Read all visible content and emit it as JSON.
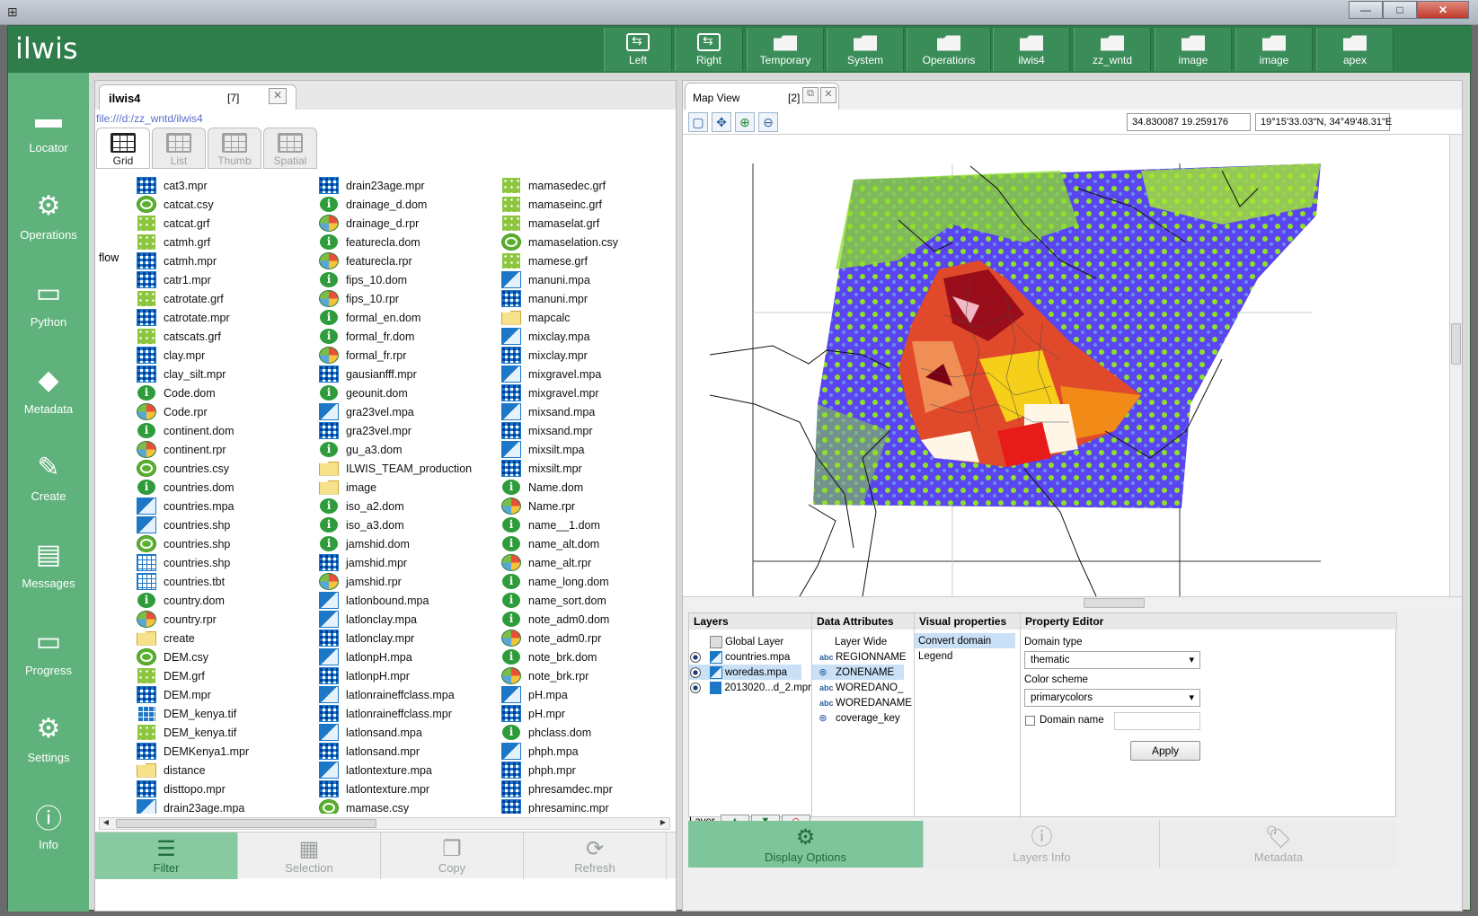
{
  "window": {
    "close": "✕",
    "maximize": "□",
    "minimize": "—"
  },
  "app": {
    "logo": "ilwis"
  },
  "toolbar": [
    {
      "label": "Left",
      "icon": "swap-icon"
    },
    {
      "label": "Right",
      "icon": "swap-icon"
    },
    {
      "label": "Temporary",
      "icon": "folder-icon"
    },
    {
      "label": "System",
      "icon": "folder-icon"
    },
    {
      "label": "Operations",
      "icon": "folder-icon"
    },
    {
      "label": "ilwis4",
      "icon": "folder-icon"
    },
    {
      "label": "zz_wntd",
      "icon": "folder-icon"
    },
    {
      "label": "image",
      "icon": "folder-icon"
    },
    {
      "label": "image",
      "icon": "folder-icon"
    },
    {
      "label": "apex",
      "icon": "folder-icon"
    }
  ],
  "sidebar": [
    {
      "label": "Locator",
      "icon": "folder-icon"
    },
    {
      "label": "Operations",
      "icon": "gears-icon"
    },
    {
      "label": "Python",
      "icon": "window-icon"
    },
    {
      "label": "Metadata",
      "icon": "tag-icon"
    },
    {
      "label": "Create",
      "icon": "edit-icon"
    },
    {
      "label": "Messages",
      "icon": "message-icon"
    },
    {
      "label": "Progress",
      "icon": "progress-icon"
    },
    {
      "label": "Settings",
      "icon": "gear-icon"
    },
    {
      "label": "Info",
      "icon": "info-icon"
    }
  ],
  "catalog": {
    "tab_title": "ilwis4",
    "tab_count": "[7]",
    "url": "file:///d:/zz_wntd/ilwis4",
    "view_tabs": [
      "Grid",
      "List",
      "Thumb",
      "Spatial"
    ],
    "side_label": "flow",
    "columns": [
      [
        {
          "name": "cat3.mpr",
          "type": "mpr"
        },
        {
          "name": "catcat.csy",
          "type": "csy"
        },
        {
          "name": "catcat.grf",
          "type": "grf"
        },
        {
          "name": "catmh.grf",
          "type": "grf"
        },
        {
          "name": "catmh.mpr",
          "type": "mpr"
        },
        {
          "name": "catr1.mpr",
          "type": "mpr"
        },
        {
          "name": "catrotate.grf",
          "type": "grf"
        },
        {
          "name": "catrotate.mpr",
          "type": "mpr"
        },
        {
          "name": "catscats.grf",
          "type": "grf"
        },
        {
          "name": "clay.mpr",
          "type": "mpr"
        },
        {
          "name": "clay_silt.mpr",
          "type": "mpr"
        },
        {
          "name": "Code.dom",
          "type": "dom"
        },
        {
          "name": "Code.rpr",
          "type": "rpr"
        },
        {
          "name": "continent.dom",
          "type": "dom"
        },
        {
          "name": "continent.rpr",
          "type": "rpr"
        },
        {
          "name": "countries.csy",
          "type": "csy"
        },
        {
          "name": "countries.dom",
          "type": "dom"
        },
        {
          "name": "countries.mpa",
          "type": "mpa"
        },
        {
          "name": "countries.shp",
          "type": "shp"
        },
        {
          "name": "countries.shp",
          "type": "csy"
        },
        {
          "name": "countries.shp",
          "type": "tbt"
        },
        {
          "name": "countries.tbt",
          "type": "tbt"
        },
        {
          "name": "country.dom",
          "type": "dom"
        },
        {
          "name": "country.rpr",
          "type": "rpr"
        },
        {
          "name": "create",
          "type": "folder"
        },
        {
          "name": "DEM.csy",
          "type": "csy"
        },
        {
          "name": "DEM.grf",
          "type": "grf"
        },
        {
          "name": "DEM.mpr",
          "type": "mpr"
        },
        {
          "name": "DEM_kenya.tif",
          "type": "tif"
        },
        {
          "name": "DEM_kenya.tif",
          "type": "grf"
        },
        {
          "name": "DEMKenya1.mpr",
          "type": "mpr"
        },
        {
          "name": "distance",
          "type": "folder"
        },
        {
          "name": "disttopo.mpr",
          "type": "mpr"
        },
        {
          "name": "drain23age.mpa",
          "type": "mpa"
        }
      ],
      [
        {
          "name": "drain23age.mpr",
          "type": "mpr"
        },
        {
          "name": "drainage_d.dom",
          "type": "dom"
        },
        {
          "name": "drainage_d.rpr",
          "type": "rpr"
        },
        {
          "name": "featurecla.dom",
          "type": "dom"
        },
        {
          "name": "featurecla.rpr",
          "type": "rpr"
        },
        {
          "name": "fips_10.dom",
          "type": "dom"
        },
        {
          "name": "fips_10.rpr",
          "type": "rpr"
        },
        {
          "name": "formal_en.dom",
          "type": "dom"
        },
        {
          "name": "formal_fr.dom",
          "type": "dom"
        },
        {
          "name": "formal_fr.rpr",
          "type": "rpr"
        },
        {
          "name": "gausianfff.mpr",
          "type": "mpr"
        },
        {
          "name": "geounit.dom",
          "type": "dom"
        },
        {
          "name": "gra23vel.mpa",
          "type": "mpa"
        },
        {
          "name": "gra23vel.mpr",
          "type": "mpr"
        },
        {
          "name": "gu_a3.dom",
          "type": "dom"
        },
        {
          "name": "ILWIS_TEAM_production",
          "type": "folder"
        },
        {
          "name": "image",
          "type": "folder"
        },
        {
          "name": "iso_a2.dom",
          "type": "dom"
        },
        {
          "name": "iso_a3.dom",
          "type": "dom"
        },
        {
          "name": "jamshid.dom",
          "type": "dom"
        },
        {
          "name": "jamshid.mpr",
          "type": "mpr"
        },
        {
          "name": "jamshid.rpr",
          "type": "rpr"
        },
        {
          "name": "latlonbound.mpa",
          "type": "mpa"
        },
        {
          "name": "latlonclay.mpa",
          "type": "mpa"
        },
        {
          "name": "latlonclay.mpr",
          "type": "mpr"
        },
        {
          "name": "latlonpH.mpa",
          "type": "mpa"
        },
        {
          "name": "latlonpH.mpr",
          "type": "mpr"
        },
        {
          "name": "latlonraineffclass.mpa",
          "type": "mpa"
        },
        {
          "name": "latlonraineffclass.mpr",
          "type": "mpr"
        },
        {
          "name": "latlonsand.mpa",
          "type": "mpa"
        },
        {
          "name": "latlonsand.mpr",
          "type": "mpr"
        },
        {
          "name": "latlontexture.mpa",
          "type": "mpa"
        },
        {
          "name": "latlontexture.mpr",
          "type": "mpr"
        },
        {
          "name": "mamase.csy",
          "type": "csy"
        }
      ],
      [
        {
          "name": "mamasedec.grf",
          "type": "grf"
        },
        {
          "name": "mamaseinc.grf",
          "type": "grf"
        },
        {
          "name": "mamaselat.grf",
          "type": "grf"
        },
        {
          "name": "mamaselation.csy",
          "type": "csy"
        },
        {
          "name": "mamese.grf",
          "type": "grf"
        },
        {
          "name": "manuni.mpa",
          "type": "mpa"
        },
        {
          "name": "manuni.mpr",
          "type": "mpr"
        },
        {
          "name": "mapcalc",
          "type": "folder"
        },
        {
          "name": "mixclay.mpa",
          "type": "mpa"
        },
        {
          "name": "mixclay.mpr",
          "type": "mpr"
        },
        {
          "name": "mixgravel.mpa",
          "type": "mpa"
        },
        {
          "name": "mixgravel.mpr",
          "type": "mpr"
        },
        {
          "name": "mixsand.mpa",
          "type": "mpa"
        },
        {
          "name": "mixsand.mpr",
          "type": "mpr"
        },
        {
          "name": "mixsilt.mpa",
          "type": "mpa"
        },
        {
          "name": "mixsilt.mpr",
          "type": "mpr"
        },
        {
          "name": "Name.dom",
          "type": "dom"
        },
        {
          "name": "Name.rpr",
          "type": "rpr"
        },
        {
          "name": "name__1.dom",
          "type": "dom"
        },
        {
          "name": "name_alt.dom",
          "type": "dom"
        },
        {
          "name": "name_alt.rpr",
          "type": "rpr"
        },
        {
          "name": "name_long.dom",
          "type": "dom"
        },
        {
          "name": "name_sort.dom",
          "type": "dom"
        },
        {
          "name": "note_adm0.dom",
          "type": "dom"
        },
        {
          "name": "note_adm0.rpr",
          "type": "rpr"
        },
        {
          "name": "note_brk.dom",
          "type": "dom"
        },
        {
          "name": "note_brk.rpr",
          "type": "rpr"
        },
        {
          "name": "pH.mpa",
          "type": "mpa"
        },
        {
          "name": "pH.mpr",
          "type": "mpr"
        },
        {
          "name": "phclass.dom",
          "type": "dom"
        },
        {
          "name": "phph.mpa",
          "type": "mpa"
        },
        {
          "name": "phph.mpr",
          "type": "mpr"
        },
        {
          "name": "phresamdec.mpr",
          "type": "mpr"
        },
        {
          "name": "phresaminc.mpr",
          "type": "mpr"
        }
      ]
    ],
    "bottom_buttons": [
      "Filter",
      "Selection",
      "Copy",
      "Refresh"
    ]
  },
  "mapview": {
    "tab_title": "Map View",
    "tab_count": "[2]",
    "coord_xy": "34.830087 19.259176",
    "coord_dms": "19°15'33.03\"N, 34°49'48.31\"E",
    "headers": [
      "Layers",
      "Data Attributes",
      "Visual properties",
      "Property Editor"
    ],
    "layers": [
      "Global Layer",
      "countries.mpa",
      "woredas.mpa",
      "2013020...d_2.mpr"
    ],
    "attributes": [
      "Layer Wide",
      "REGIONNAME",
      "ZONENAME",
      "WOREDANO_",
      "WOREDANAME",
      "coverage_key"
    ],
    "visual": [
      "Convert domain",
      "Legend"
    ],
    "editor": {
      "domain_type_label": "Domain type",
      "domain_type_value": "thematic",
      "color_scheme_label": "Color scheme",
      "color_scheme_value": "primarycolors",
      "domain_name_label": "Domain name",
      "apply": "Apply"
    },
    "layer_label": "Layer",
    "bottom_buttons": [
      "Display Options",
      "Layers Info",
      "Metadata"
    ]
  }
}
